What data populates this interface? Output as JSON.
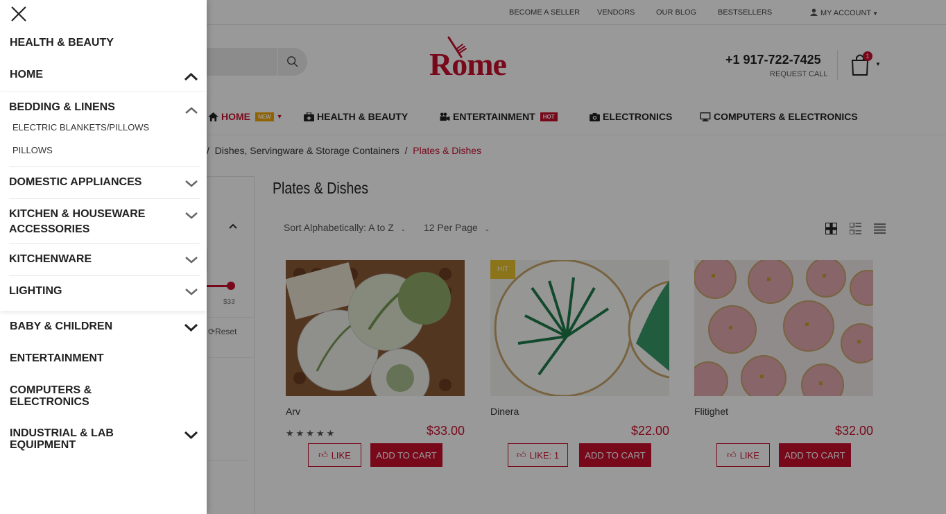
{
  "topbar": {
    "links": [
      "BECOME A SELLER",
      "VENDORS",
      "OUR BLOG",
      "BESTSELLERS"
    ],
    "account": "MY ACCOUNT"
  },
  "header": {
    "logo_text": "Rome",
    "phone": "+1 917-722-7425",
    "request_call": "REQUEST CALL",
    "cart_count": "1"
  },
  "mainnav": {
    "items": [
      {
        "label": "HOME",
        "tag": "NEW"
      },
      {
        "label": "HEALTH & BEAUTY"
      },
      {
        "label": "ENTERTAINMENT",
        "tag": "HOT"
      },
      {
        "label": "ELECTRONICS"
      },
      {
        "label": "COMPUTERS & ELECTRONICS"
      }
    ]
  },
  "breadcrumb": {
    "parent": "Dishes, Servingware & Storage Containers",
    "separator": "/",
    "current": "Plates & Dishes"
  },
  "filters": {
    "price_max": "$33",
    "reset": "Reset"
  },
  "listing": {
    "title": "Plates & Dishes",
    "sort": "Sort Alphabetically: A to Z",
    "per_page": "12 Per Page"
  },
  "products": [
    {
      "name": "Arv",
      "price": "$33.00",
      "like": "LIKE",
      "cart": "ADD TO CART",
      "stars": "★★★★★"
    },
    {
      "name": "Dinera",
      "price": "$22.00",
      "like": "LIKE: 1",
      "cart": "ADD TO CART",
      "badge": "HIT"
    },
    {
      "name": "Flitighet",
      "price": "$32.00",
      "like": "LIKE",
      "cart": "ADD TO CART"
    }
  ],
  "drawer": {
    "top_items": [
      "HEALTH & BEAUTY",
      "HOME"
    ],
    "submenu": {
      "title": "BEDDING & LINENS",
      "children": [
        "ELECTRIC BLANKETS/PILLOWS",
        "PILLOWS"
      ],
      "items": [
        "DOMESTIC APPLIANCES",
        "KITCHEN & HOUSEWARE ACCESSORIES",
        "KITCHENWARE",
        "LIGHTING"
      ]
    },
    "bottom_items": [
      "BABY & CHILDREN",
      "ENTERTAINMENT",
      "COMPUTERS & ELECTRONICS",
      "INDUSTRIAL & LAB EQUIPMENT"
    ]
  },
  "colors": {
    "accent": "#c8102e",
    "hit_badge": "#e8c22a",
    "new_tag": "#f0a500"
  }
}
